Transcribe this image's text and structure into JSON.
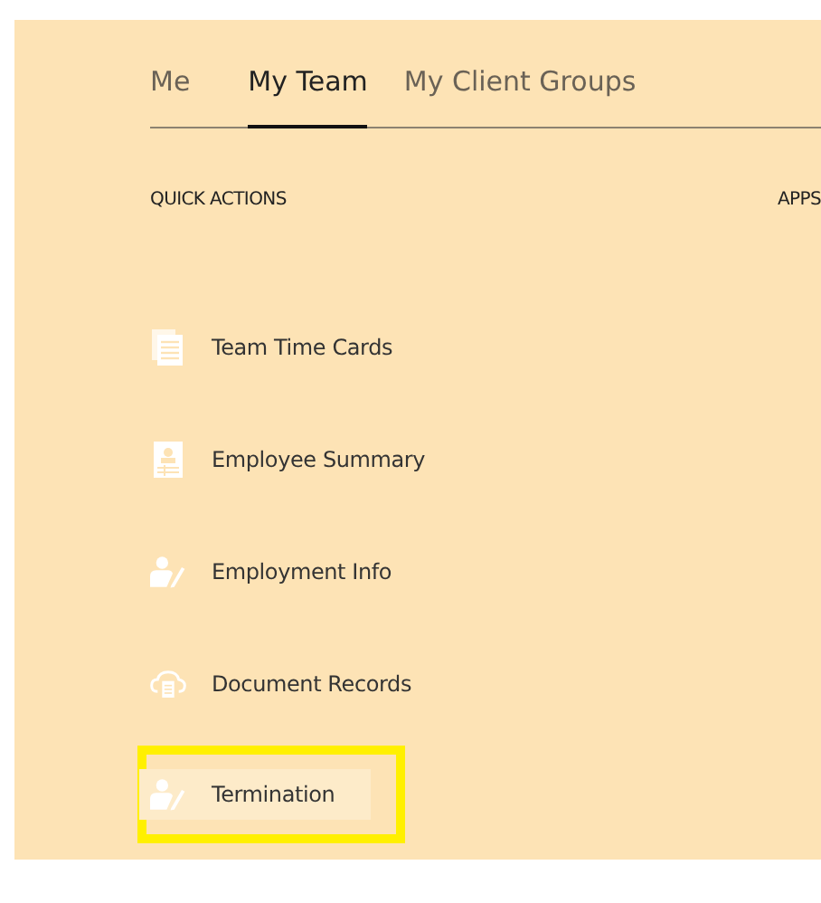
{
  "tabs": [
    {
      "label": "Me",
      "selected": false
    },
    {
      "label": "My Team",
      "selected": true
    },
    {
      "label": "My Client Groups",
      "selected": false
    }
  ],
  "quick_actions": {
    "heading": "QUICK ACTIONS",
    "items": [
      {
        "label": "Team Time Cards",
        "kind": "cards",
        "highlighted": false
      },
      {
        "label": "Employee Summary",
        "kind": "badge",
        "highlighted": false
      },
      {
        "label": "Employment Info",
        "kind": "person",
        "highlighted": false
      },
      {
        "label": "Document Records",
        "kind": "cloud",
        "highlighted": false
      },
      {
        "label": "Termination",
        "kind": "person",
        "highlighted": true
      }
    ]
  },
  "apps": {
    "heading": "APPS"
  }
}
